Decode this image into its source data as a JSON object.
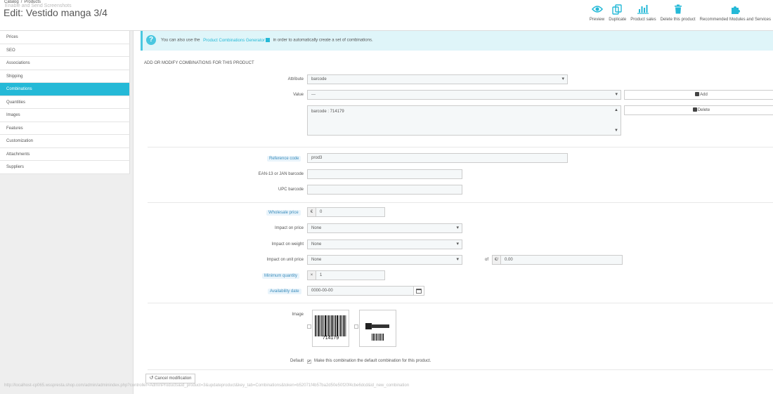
{
  "header": {
    "breadcrumb": [
      "Catalog",
      "/",
      "Products"
    ],
    "overlay_text": "Enable and Send Screenshots",
    "title": "Edit: Vestido manga 3/4",
    "toolbar": [
      {
        "label": "Preview",
        "icon": "eye-icon"
      },
      {
        "label": "Duplicate",
        "icon": "copy-icon"
      },
      {
        "label": "Product sales",
        "icon": "bar-chart-icon"
      },
      {
        "label": "Delete this product",
        "icon": "trash-icon"
      },
      {
        "label": "Recommended Modules and Services",
        "icon": "puzzle-icon"
      }
    ]
  },
  "sidebar": {
    "tabs": [
      {
        "label": "Prices"
      },
      {
        "label": "SEO"
      },
      {
        "label": "Associations"
      },
      {
        "label": "Shipping"
      },
      {
        "label": "Combinations",
        "active": true
      },
      {
        "label": "Quantities"
      },
      {
        "label": "Images"
      },
      {
        "label": "Features"
      },
      {
        "label": "Customization"
      },
      {
        "label": "Attachments"
      },
      {
        "label": "Suppliers"
      }
    ]
  },
  "info": {
    "prefix": "You can also use the",
    "link": "Product Combinations Generator",
    "suffix": "in order to automatically create a set of combinations."
  },
  "form": {
    "panel_title": "ADD OR MODIFY COMBINATIONS FOR THIS PRODUCT",
    "attribute_label": "Attribute",
    "attribute_value": "barcode",
    "value_label": "Value",
    "value_value": "---",
    "add_button": "Add",
    "delete_button": "Delete",
    "selected_item": "barcode : 714179",
    "reference_label": "Reference code",
    "reference_value": "prod3",
    "ean_label": "EAN-13 or JAN barcode",
    "ean_value": "",
    "upc_label": "UPC barcode",
    "upc_value": "",
    "wholesale_label": "Wholesale price",
    "wholesale_currency": "€",
    "wholesale_value": "0",
    "impact_price_label": "Impact on price",
    "impact_price_value": "None",
    "impact_weight_label": "Impact on weight",
    "impact_weight_value": "None",
    "impact_unit_label": "Impact on unit price",
    "impact_unit_value": "None",
    "of_label": "of",
    "unit_currency": "€/",
    "unit_value": "0.00",
    "min_qty_label": "Minimum quantity",
    "min_qty_prefix": "×",
    "min_qty_value": "1",
    "availability_label": "Availability date",
    "availability_value": "0000-00-00",
    "image_label": "Image",
    "barcode_number": "714179",
    "default_label": "Default",
    "default_text": "Make this combination the default combination for this product.",
    "cancel_button": "Cancel modification"
  },
  "status_url": "http://localhost-cp065.wsspresta.shop.com/admin/adminindex.php?controller=AdminProducts&id_product=3&updateproduct&key_tab=Combinations&token=b52071f4b57ba2d50e50f20f4cbe6dcd&id_new_combination",
  "colors": {
    "accent": "#25b9d7",
    "info_bg": "#dff5f9"
  }
}
